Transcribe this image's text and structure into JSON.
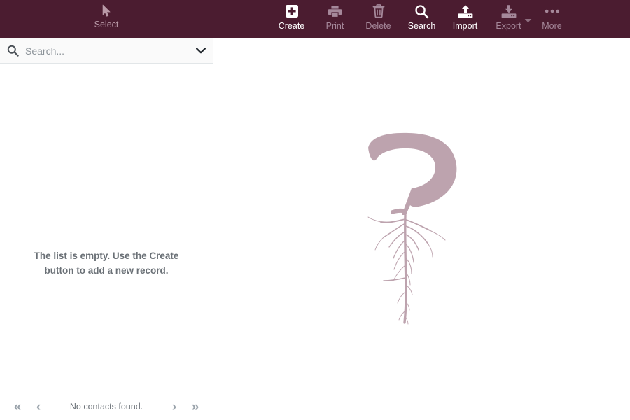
{
  "theme": {
    "brand_maroon": "#4b1c30",
    "toolbar_label_active": "#ffffff",
    "toolbar_label_disabled": "#a5889a",
    "logo_mauve": "#bda3ae",
    "panel_border": "#c9d2d6",
    "search_bg": "#fafafa",
    "muted_text": "#6a7076",
    "pagination_icon": "#9aa3ab"
  },
  "left_panel": {
    "select_header": {
      "label": "Select",
      "icon": "cursor-arrow-icon"
    },
    "search": {
      "placeholder": "Search...",
      "value": "",
      "search_icon": "search-icon",
      "chevron_icon": "chevron-down-icon"
    },
    "empty_state": {
      "message": "The list is empty. Use the Create button to add a new record."
    },
    "pagination": {
      "first_label": "«",
      "prev_label": "‹",
      "next_label": "›",
      "last_label": "»",
      "status": "No contacts found."
    }
  },
  "toolbar": {
    "items": [
      {
        "label": "Create",
        "icon": "add-box-icon",
        "enabled": true,
        "has_caret": false
      },
      {
        "label": "Print",
        "icon": "printer-icon",
        "enabled": false,
        "has_caret": false
      },
      {
        "label": "Delete",
        "icon": "trash-icon",
        "enabled": false,
        "has_caret": false
      },
      {
        "label": "Search",
        "icon": "search-icon",
        "enabled": true,
        "has_caret": false
      },
      {
        "label": "Import",
        "icon": "upload-icon",
        "enabled": true,
        "has_caret": false
      },
      {
        "label": "Export",
        "icon": "download-icon",
        "enabled": false,
        "has_caret": true
      },
      {
        "label": "More",
        "icon": "ellipsis-icon",
        "enabled": false,
        "has_caret": false
      }
    ]
  },
  "content": {
    "watermark": {
      "name": "application-logo-watermark",
      "description": "Stylized letter P with root system"
    }
  }
}
